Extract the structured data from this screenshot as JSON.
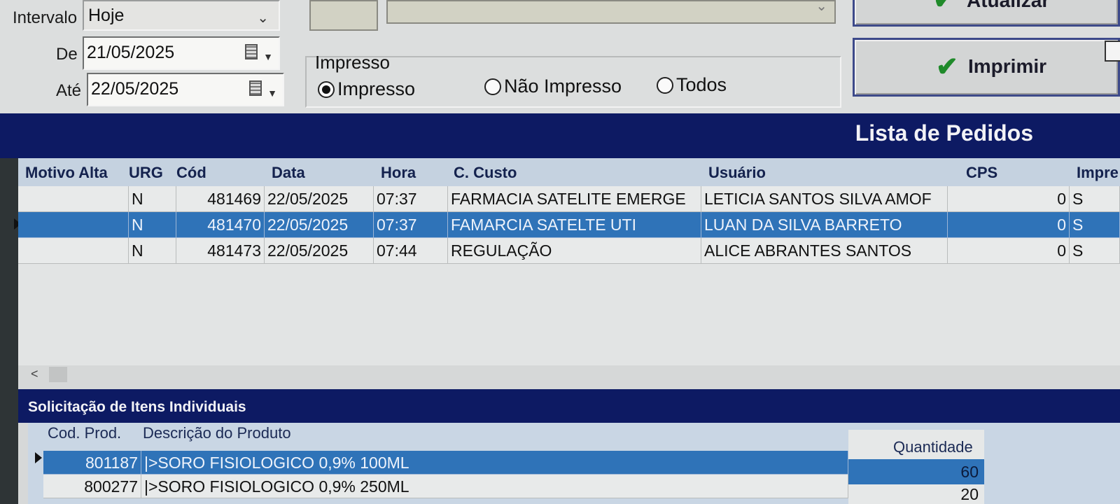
{
  "filters": {
    "interval_label": "Intervalo",
    "interval_value": "Hoje",
    "from_label": "De",
    "from_value": "21/05/2025",
    "to_label": "Até",
    "to_value": "22/05/2025"
  },
  "print_status": {
    "group_label": "Impresso",
    "options": [
      "Impresso",
      "Não Impresso",
      "Todos"
    ],
    "selected": "Impresso"
  },
  "buttons": {
    "update_label": "Atualizar",
    "print_label": "Imprimir"
  },
  "orders": {
    "title": "Lista de Pedidos",
    "columns": [
      "Motivo Alta",
      "URG",
      "Cód",
      "Data",
      "Hora",
      "C. Custo",
      "Usuário",
      "CPS",
      "Impre"
    ],
    "rows": [
      {
        "motivo": "",
        "urg": "N",
        "cod": "481469",
        "data": "22/05/2025",
        "hora": "07:37",
        "custo": "FARMACIA SATELITE EMERGE",
        "usuario": "LETICIA SANTOS SILVA AMOF",
        "cps": "0",
        "impresso": "S"
      },
      {
        "motivo": "",
        "urg": "N",
        "cod": "481470",
        "data": "22/05/2025",
        "hora": "07:37",
        "custo": "FAMARCIA SATELTE UTI",
        "usuario": "LUAN DA SILVA BARRETO",
        "cps": "0",
        "impresso": "S"
      },
      {
        "motivo": "",
        "urg": "N",
        "cod": "481473",
        "data": "22/05/2025",
        "hora": "07:44",
        "custo": "REGULAÇÃO",
        "usuario": "ALICE ABRANTES SANTOS",
        "cps": "0",
        "impresso": "S"
      }
    ],
    "selected_row": 1,
    "scroll_left": "<"
  },
  "items": {
    "title": "Solicitação de Itens Individuais",
    "columns": [
      "Cod. Prod.",
      "Descrição do Produto",
      "Quantidade"
    ],
    "rows": [
      {
        "cod": "801187",
        "descricao": "|>SORO FISIOLOGICO 0,9% 100ML",
        "quantidade": "60"
      },
      {
        "cod": "800277",
        "descricao": "|>SORO FISIOLOGICO 0,9% 250ML",
        "quantidade": "20"
      }
    ]
  },
  "colors": {
    "navy_bar": "#0d1a63",
    "selection": "#2f73b8",
    "check_green": "#1f8a2a"
  }
}
